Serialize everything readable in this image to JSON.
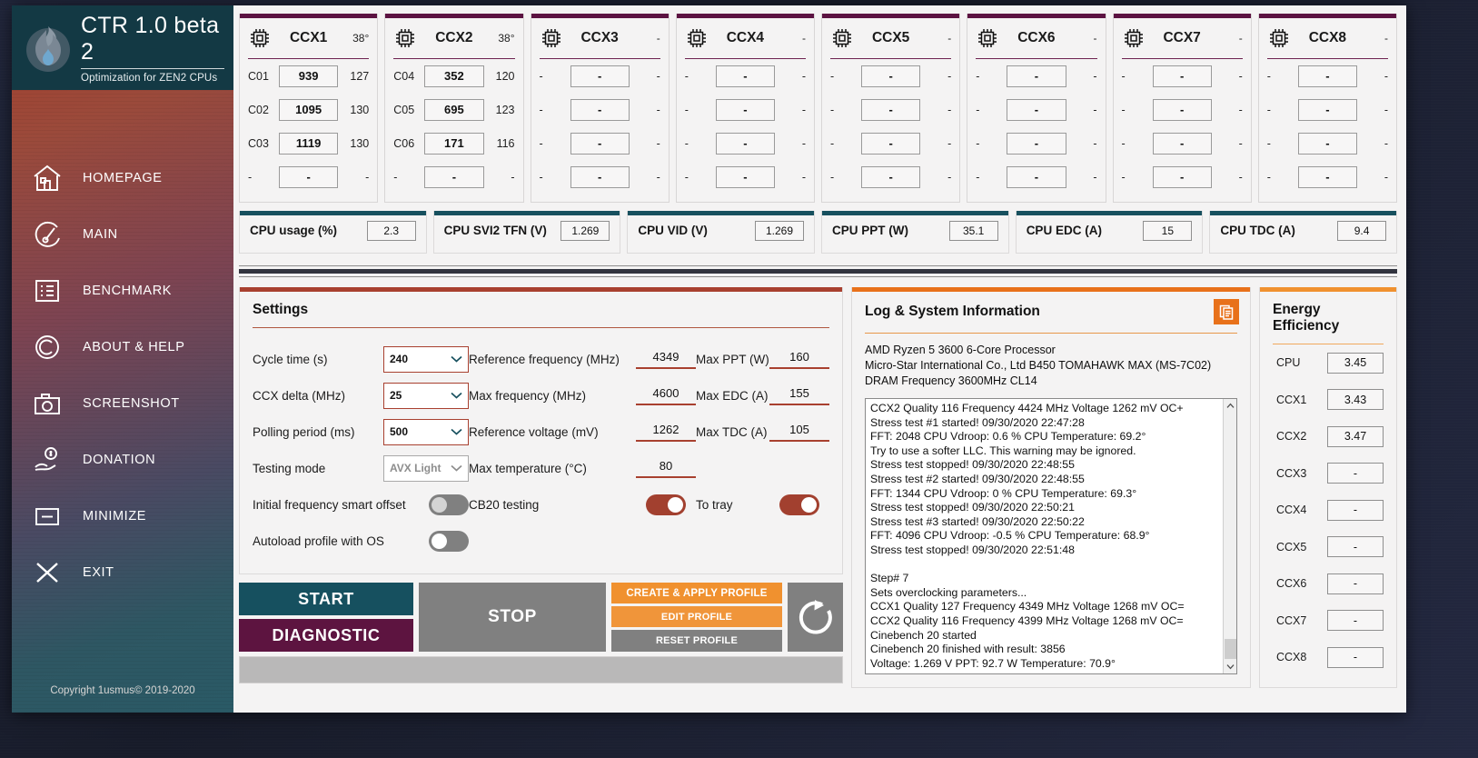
{
  "sidebar": {
    "brand_title": "CTR 1.0 beta 2",
    "brand_subtitle": "Optimization for ZEN2 CPUs",
    "items": [
      {
        "label": "HOMEPAGE",
        "icon": "home-icon"
      },
      {
        "label": "MAIN",
        "icon": "gauge-icon"
      },
      {
        "label": "BENCHMARK",
        "icon": "list-icon"
      },
      {
        "label": "ABOUT & HELP",
        "icon": "copyright-icon"
      },
      {
        "label": "SCREENSHOT",
        "icon": "camera-icon"
      },
      {
        "label": "DONATION",
        "icon": "hand-coin-icon"
      },
      {
        "label": "MINIMIZE",
        "icon": "minimize-icon"
      },
      {
        "label": "EXIT",
        "icon": "close-x-icon"
      }
    ],
    "copyright": "Copyright 1usmus© 2019-2020"
  },
  "ccx_panels": [
    {
      "name": "CCX1",
      "temp": "38°",
      "cores": [
        {
          "id": "C01",
          "freq": "939",
          "aux": "127"
        },
        {
          "id": "C02",
          "freq": "1095",
          "aux": "130"
        },
        {
          "id": "C03",
          "freq": "1119",
          "aux": "130"
        },
        {
          "id": "-",
          "freq": "-",
          "aux": "-"
        }
      ]
    },
    {
      "name": "CCX2",
      "temp": "38°",
      "cores": [
        {
          "id": "C04",
          "freq": "352",
          "aux": "120"
        },
        {
          "id": "C05",
          "freq": "695",
          "aux": "123"
        },
        {
          "id": "C06",
          "freq": "171",
          "aux": "116"
        },
        {
          "id": "-",
          "freq": "-",
          "aux": "-"
        }
      ]
    },
    {
      "name": "CCX3",
      "temp": "-",
      "cores": [
        {
          "id": "-",
          "freq": "-",
          "aux": "-"
        },
        {
          "id": "-",
          "freq": "-",
          "aux": "-"
        },
        {
          "id": "-",
          "freq": "-",
          "aux": "-"
        },
        {
          "id": "-",
          "freq": "-",
          "aux": "-"
        }
      ]
    },
    {
      "name": "CCX4",
      "temp": "-",
      "cores": [
        {
          "id": "-",
          "freq": "-",
          "aux": "-"
        },
        {
          "id": "-",
          "freq": "-",
          "aux": "-"
        },
        {
          "id": "-",
          "freq": "-",
          "aux": "-"
        },
        {
          "id": "-",
          "freq": "-",
          "aux": "-"
        }
      ]
    },
    {
      "name": "CCX5",
      "temp": "-",
      "cores": [
        {
          "id": "-",
          "freq": "-",
          "aux": "-"
        },
        {
          "id": "-",
          "freq": "-",
          "aux": "-"
        },
        {
          "id": "-",
          "freq": "-",
          "aux": "-"
        },
        {
          "id": "-",
          "freq": "-",
          "aux": "-"
        }
      ]
    },
    {
      "name": "CCX6",
      "temp": "-",
      "cores": [
        {
          "id": "-",
          "freq": "-",
          "aux": "-"
        },
        {
          "id": "-",
          "freq": "-",
          "aux": "-"
        },
        {
          "id": "-",
          "freq": "-",
          "aux": "-"
        },
        {
          "id": "-",
          "freq": "-",
          "aux": "-"
        }
      ]
    },
    {
      "name": "CCX7",
      "temp": "-",
      "cores": [
        {
          "id": "-",
          "freq": "-",
          "aux": "-"
        },
        {
          "id": "-",
          "freq": "-",
          "aux": "-"
        },
        {
          "id": "-",
          "freq": "-",
          "aux": "-"
        },
        {
          "id": "-",
          "freq": "-",
          "aux": "-"
        }
      ]
    },
    {
      "name": "CCX8",
      "temp": "-",
      "cores": [
        {
          "id": "-",
          "freq": "-",
          "aux": "-"
        },
        {
          "id": "-",
          "freq": "-",
          "aux": "-"
        },
        {
          "id": "-",
          "freq": "-",
          "aux": "-"
        },
        {
          "id": "-",
          "freq": "-",
          "aux": "-"
        }
      ]
    }
  ],
  "metrics": [
    {
      "label": "CPU usage (%)",
      "value": "2.3"
    },
    {
      "label": "CPU SVI2 TFN (V)",
      "value": "1.269"
    },
    {
      "label": "CPU VID (V)",
      "value": "1.269"
    },
    {
      "label": "CPU PPT (W)",
      "value": "35.1"
    },
    {
      "label": "CPU EDC (A)",
      "value": "15"
    },
    {
      "label": "CPU TDC (A)",
      "value": "9.4"
    }
  ],
  "settings": {
    "title": "Settings",
    "selects": [
      {
        "label": "Cycle time (s)",
        "value": "240",
        "disabled": false
      },
      {
        "label": "CCX delta (MHz)",
        "value": "25",
        "disabled": false
      },
      {
        "label": "Polling period (ms)",
        "value": "500",
        "disabled": false
      },
      {
        "label": "Testing mode",
        "value": "AVX Light",
        "disabled": true
      }
    ],
    "toggles_left": [
      {
        "label": "Initial frequency smart offset",
        "on": false,
        "knob_white": false
      },
      {
        "label": "Autoload profile with OS",
        "on": false,
        "knob_white": true
      }
    ],
    "col2": [
      {
        "label": "Reference frequency (MHz)",
        "value": "4349"
      },
      {
        "label": "Max frequency (MHz)",
        "value": "4600"
      },
      {
        "label": "Reference voltage (mV)",
        "value": "1262"
      },
      {
        "label": "Max temperature (°C)",
        "value": "80"
      }
    ],
    "col2_toggle": {
      "label": "CB20 testing",
      "on": true
    },
    "col3": [
      {
        "label": "Max PPT (W)",
        "value": "160"
      },
      {
        "label": "Max EDC (A)",
        "value": "155"
      },
      {
        "label": "Max TDC (A)",
        "value": "105"
      }
    ],
    "col3_toggle": {
      "label": "To tray",
      "on": true
    }
  },
  "buttons": {
    "start": "START",
    "diagnostic": "DIAGNOSTIC",
    "stop": "STOP",
    "create_apply_profile": "CREATE & APPLY PROFILE",
    "edit_profile": "EDIT PROFILE",
    "reset_profile": "RESET PROFILE",
    "refresh_icon": "refresh-icon"
  },
  "log": {
    "title": "Log & System Information",
    "copy_icon": "copy-document-icon",
    "sysinfo": [
      "AMD Ryzen 5 3600 6-Core Processor",
      "Micro-Star International Co., Ltd B450 TOMAHAWK MAX (MS-7C02)",
      "DRAM Frequency 3600MHz CL14"
    ],
    "lines": [
      "CCX2  Quality 116  Frequency 4424 MHz  Voltage 1262 mV  OC+",
      "Stress test #1 started!  09/30/2020 22:47:28",
      "FFT: 2048  CPU Vdroop: 0.6 %  CPU Temperature: 69.2°",
      "Try to use a softer LLC. This warning may be ignored.",
      "Stress test stopped!  09/30/2020 22:48:55",
      "Stress test #2 started!  09/30/2020 22:48:55",
      "FFT: 1344  CPU Vdroop: 0 %  CPU Temperature: 69.3°",
      "Stress test stopped!  09/30/2020 22:50:21",
      "Stress test #3 started!  09/30/2020 22:50:22",
      "FFT: 4096  CPU Vdroop: -0.5 %  CPU Temperature: 68.9°",
      "Stress test stopped!  09/30/2020 22:51:48",
      "",
      "Step# 7",
      "Sets overclocking parameters...",
      "CCX1  Quality 127  Frequency 4349 MHz  Voltage 1268 mV  OC=",
      "CCX2  Quality 116  Frequency 4399 MHz  Voltage 1268 mV  OC=",
      "Cinebench 20 started",
      "Cinebench 20 finished with result: 3856",
      "Voltage: 1.269 V  PPT: 92.7 W  Temperature: 70.9°"
    ]
  },
  "energy": {
    "title": "Energy Efficiency",
    "rows": [
      {
        "label": "CPU",
        "value": "3.45"
      },
      {
        "label": "CCX1",
        "value": "3.43"
      },
      {
        "label": "CCX2",
        "value": "3.47"
      },
      {
        "label": "CCX3",
        "value": "-"
      },
      {
        "label": "CCX4",
        "value": "-"
      },
      {
        "label": "CCX5",
        "value": "-"
      },
      {
        "label": "CCX6",
        "value": "-"
      },
      {
        "label": "CCX7",
        "value": "-"
      },
      {
        "label": "CCX8",
        "value": "-"
      }
    ]
  },
  "colors": {
    "ccx_accent": "#5c1342",
    "metric_accent": "#17505e",
    "settings_accent": "#a8402f",
    "log_accent": "#e8711a",
    "energy_accent": "#f0912f",
    "start_button": "#16505f",
    "diagnostic_button": "#5d1440",
    "profile_button": "#f0912f"
  }
}
